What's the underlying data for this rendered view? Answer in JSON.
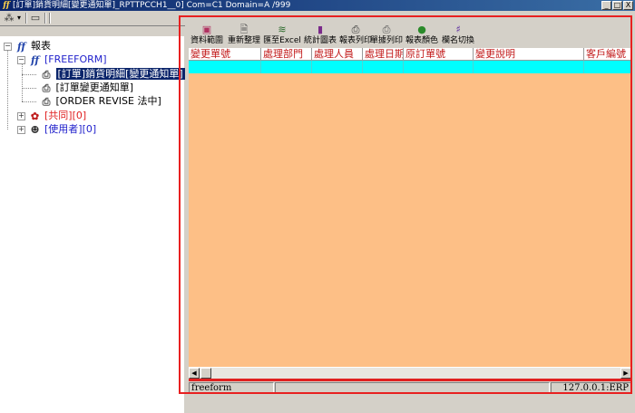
{
  "window": {
    "title": "[訂單]銷貨明細[變更通知單]_RPTTPCCH1__0] Com=C1 Domain=A /999",
    "buttons": {
      "minimize": "_",
      "maximize": "□",
      "close": "X"
    }
  },
  "app_toolbar": {
    "tree_btn": "⁂",
    "dropdown": "▾",
    "page_btn": "▭"
  },
  "tree": {
    "root": {
      "label": "報表"
    },
    "freeform": {
      "label": "[FREEFORM]"
    },
    "items": [
      {
        "label": "[訂單]銷貨明細[變更通知單]",
        "selected": true
      },
      {
        "label": "[訂單變更通知單]"
      },
      {
        "label": "[ORDER REVISE 法中]"
      }
    ],
    "shared": {
      "label": "[共同][0]"
    },
    "user": {
      "label": "[使用者][0]"
    }
  },
  "report_toolbar": {
    "buttons": [
      {
        "label": "資料範圍",
        "icon": "window-icon",
        "glyph": "▣",
        "color": "#b03060"
      },
      {
        "label": "重新整理",
        "icon": "page-icon",
        "glyph": "🗎",
        "color": "#555555"
      },
      {
        "label": "匯至Excel",
        "icon": "export-icon",
        "glyph": "≋",
        "color": "#2a6a2a"
      },
      {
        "label": "統計圖表",
        "icon": "chart-icon",
        "glyph": "▮",
        "color": "#7a2a8a"
      },
      {
        "label": "報表列印",
        "icon": "print-icon",
        "glyph": "⎙",
        "color": "#333333"
      },
      {
        "label": "單據列印",
        "icon": "printer-icon",
        "glyph": "⎙",
        "color": "#555555"
      },
      {
        "label": "報表顏色",
        "icon": "color-icon",
        "glyph": "●",
        "color": "#2a8a2a"
      },
      {
        "label": "欄名切換",
        "icon": "switch-icon",
        "glyph": "♯",
        "color": "#5a2aa0"
      }
    ]
  },
  "grid": {
    "columns": [
      "變更單號",
      "處理部門",
      "處理人員",
      "處理日期",
      "原訂單號",
      "變更說明",
      "客戶編號"
    ],
    "background": "#fdbf86",
    "row_color": "#00ffff"
  },
  "status": {
    "left": "freeform",
    "middle": "",
    "right": "127.0.0.1:ERP"
  }
}
